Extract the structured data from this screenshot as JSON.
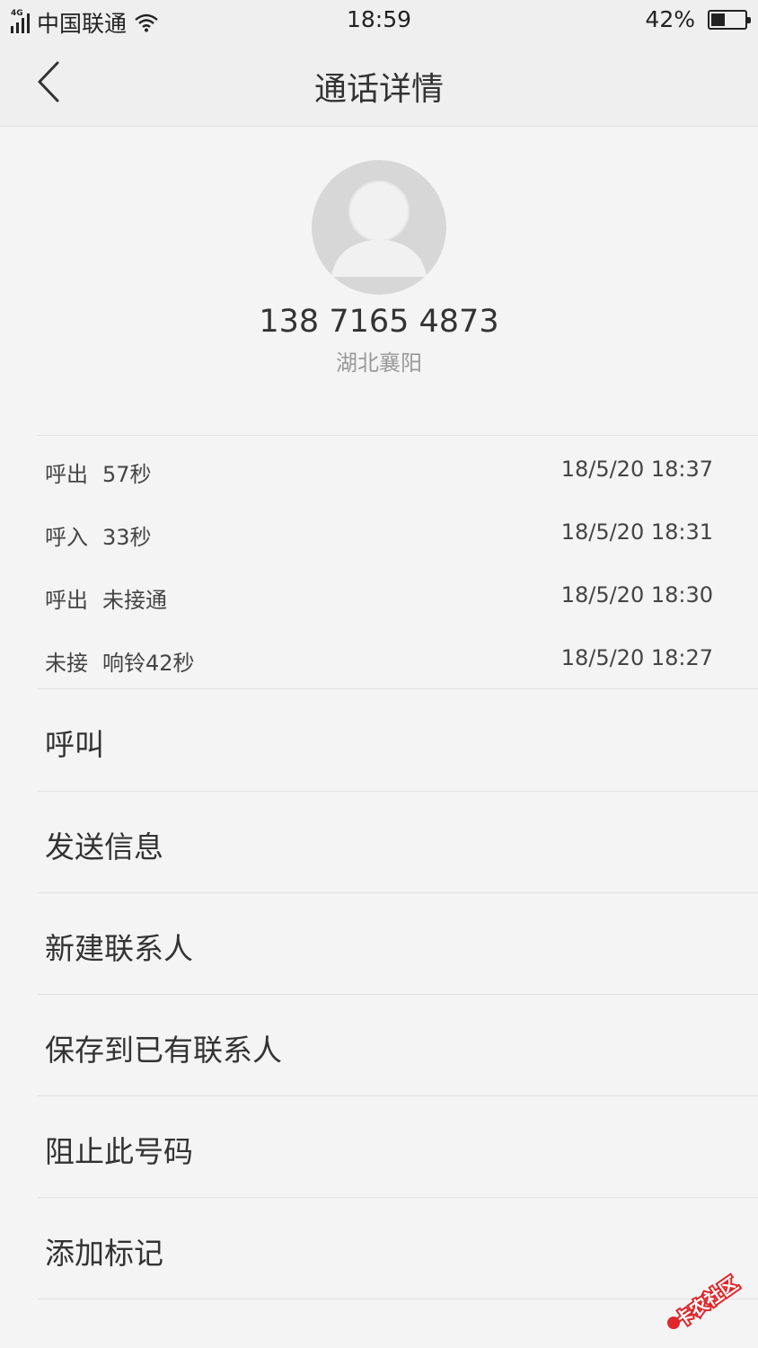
{
  "status_bar": {
    "network": "4G",
    "carrier": "中国联通",
    "time": "18:59",
    "battery_percent": "42%",
    "battery_level": 0.42
  },
  "header": {
    "title": "通话详情",
    "back_icon": "chevron-left-icon"
  },
  "contact": {
    "avatar_icon": "default-avatar-icon",
    "number": "138 7165 4873",
    "location": "湖北襄阳"
  },
  "call_log": [
    {
      "type": "呼出",
      "detail": "57秒",
      "time": "18/5/20 18:37"
    },
    {
      "type": "呼入",
      "detail": "33秒",
      "time": "18/5/20 18:31"
    },
    {
      "type": "呼出",
      "detail": "未接通",
      "time": "18/5/20 18:30"
    },
    {
      "type": "未接",
      "detail": "响铃42秒",
      "time": "18/5/20 18:27"
    }
  ],
  "actions": [
    {
      "label": "呼叫"
    },
    {
      "label": "发送信息"
    },
    {
      "label": "新建联系人"
    },
    {
      "label": "保存到已有联系人"
    },
    {
      "label": "阻止此号码"
    },
    {
      "label": "添加标记"
    }
  ],
  "watermark": {
    "text": "卡农社区",
    "color": "#e0262b"
  }
}
